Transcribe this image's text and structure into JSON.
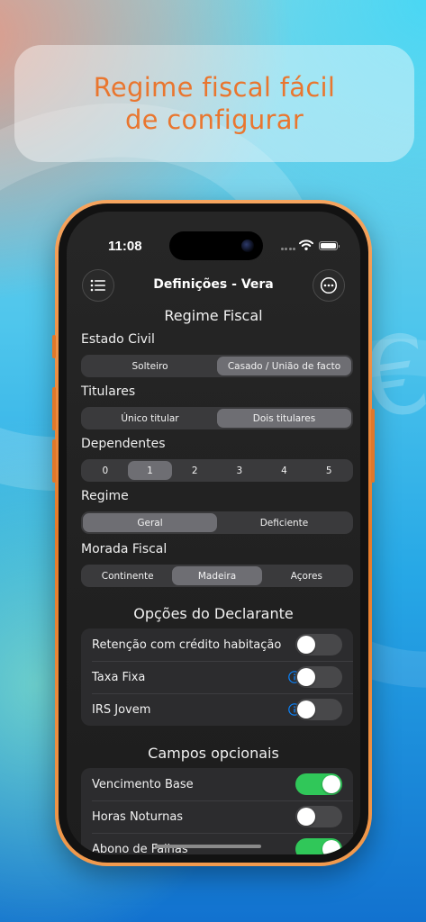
{
  "banner": {
    "line1": "Regime fiscal fácil",
    "line2": "de configurar"
  },
  "status_bar": {
    "time": "11:08"
  },
  "nav": {
    "title": "Definições - Vera",
    "left_icon": "list-icon",
    "right_icon": "ellipsis-circle-icon"
  },
  "regime_fiscal": {
    "title": "Regime Fiscal",
    "estado_civil": {
      "label": "Estado Civil",
      "options": [
        "Solteiro",
        "Casado / União de facto"
      ],
      "selected": "Casado / União de facto"
    },
    "titulares": {
      "label": "Titulares",
      "options": [
        "Único titular",
        "Dois titulares"
      ],
      "selected": "Dois titulares"
    },
    "dependentes": {
      "label": "Dependentes",
      "options": [
        "0",
        "1",
        "2",
        "3",
        "4",
        "5"
      ],
      "selected": "1"
    },
    "regime": {
      "label": "Regime",
      "options": [
        "Geral",
        "Deficiente"
      ],
      "selected": "Geral"
    },
    "morada_fiscal": {
      "label": "Morada Fiscal",
      "options": [
        "Continente",
        "Madeira",
        "Açores"
      ],
      "selected": "Madeira"
    }
  },
  "opcoes_declarante": {
    "title": "Opções do Declarante",
    "rows": [
      {
        "label": "Retenção com crédito habitação",
        "on": false,
        "info": false
      },
      {
        "label": "Taxa Fixa",
        "on": false,
        "info": true
      },
      {
        "label": "IRS Jovem",
        "on": false,
        "info": true
      }
    ]
  },
  "campos_opcionais": {
    "title": "Campos opcionais",
    "rows": [
      {
        "label": "Vencimento Base",
        "on": true
      },
      {
        "label": "Horas Noturnas",
        "on": false
      },
      {
        "label": "Abono de Falhas",
        "on": true
      }
    ]
  },
  "colors": {
    "accent_text": "#e9762f",
    "toggle_on": "#30c759",
    "info_blue": "#0a84ff",
    "frame": "#e57a2a"
  }
}
